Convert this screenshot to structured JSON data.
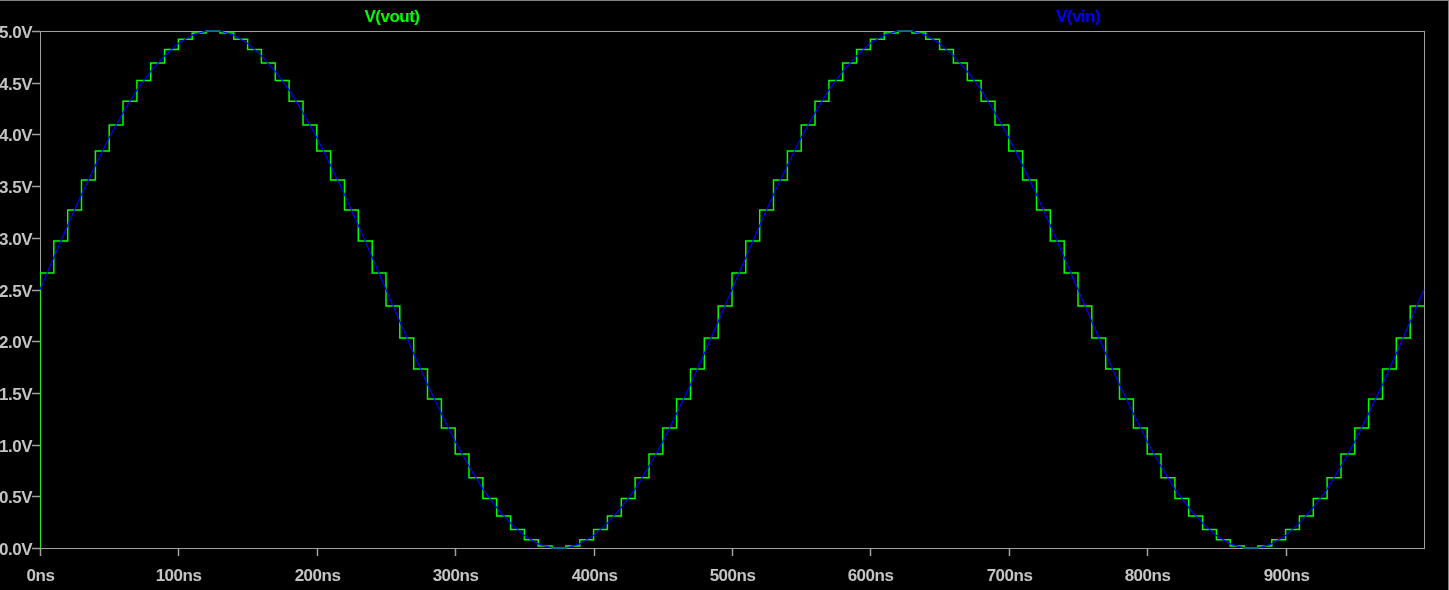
{
  "chart_data": {
    "type": "line",
    "xlim": [
      0,
      1000
    ],
    "ylim": [
      0,
      5
    ],
    "xticks": [
      {
        "value": 0,
        "label": "0ns"
      },
      {
        "value": 100,
        "label": "100ns"
      },
      {
        "value": 200,
        "label": "200ns"
      },
      {
        "value": 300,
        "label": "300ns"
      },
      {
        "value": 400,
        "label": "400ns"
      },
      {
        "value": 500,
        "label": "500ns"
      },
      {
        "value": 600,
        "label": "600ns"
      },
      {
        "value": 700,
        "label": "700ns"
      },
      {
        "value": 800,
        "label": "800ns"
      },
      {
        "value": 900,
        "label": "900ns"
      }
    ],
    "yticks": [
      {
        "value": 0,
        "label": "0.0V"
      },
      {
        "value": 0.5,
        "label": "0.5V"
      },
      {
        "value": 1,
        "label": "1.0V"
      },
      {
        "value": 1.5,
        "label": "1.5V"
      },
      {
        "value": 2,
        "label": "2.0V"
      },
      {
        "value": 2.5,
        "label": "2.5V"
      },
      {
        "value": 3,
        "label": "3.0V"
      },
      {
        "value": 3.5,
        "label": "3.5V"
      },
      {
        "value": 4,
        "label": "4.0V"
      },
      {
        "value": 4.5,
        "label": "4.5V"
      },
      {
        "value": 5,
        "label": "5.0V"
      }
    ],
    "x": [
      0,
      0,
      10,
      10,
      20,
      20,
      30,
      30,
      40,
      40,
      50,
      50,
      60,
      60,
      70,
      70,
      80,
      80,
      90,
      90,
      100,
      100,
      110,
      110,
      120,
      120,
      130,
      130,
      140,
      140,
      150,
      150,
      160,
      160,
      170,
      170,
      180,
      180,
      190,
      190,
      200,
      200,
      210,
      210,
      220,
      220,
      230,
      230,
      240,
      240,
      250,
      250,
      260,
      260,
      270,
      270,
      280,
      280,
      290,
      290,
      300,
      300,
      310,
      310,
      320,
      320,
      330,
      330,
      340,
      340,
      350,
      350,
      360,
      360,
      370,
      370,
      380,
      380,
      390,
      390,
      400,
      400,
      410,
      410,
      420,
      420,
      430,
      430,
      440,
      440,
      450,
      450,
      460,
      460,
      470,
      470,
      480,
      480,
      490,
      490,
      500,
      500,
      510,
      510,
      520,
      520,
      530,
      530,
      540,
      540,
      550,
      550,
      560,
      560,
      570,
      570,
      580,
      580,
      590,
      590,
      600,
      600,
      610,
      610,
      620,
      620,
      630,
      630,
      640,
      640,
      650,
      650,
      660,
      660,
      670,
      670,
      680,
      680,
      690,
      690,
      700,
      700,
      710,
      710,
      720,
      720,
      730,
      730,
      740,
      740,
      750,
      750,
      760,
      760,
      770,
      770,
      780,
      780,
      790,
      790,
      800,
      800,
      810,
      810,
      820,
      820,
      830,
      830,
      840,
      840,
      850,
      850,
      860,
      860,
      870,
      870,
      880,
      880,
      890,
      890,
      900,
      900,
      910,
      910,
      920,
      920,
      930,
      930,
      940,
      940,
      950,
      950,
      960,
      960,
      970,
      970,
      980,
      980,
      990,
      990,
      1000
    ],
    "series": [
      {
        "name": "V(vout)",
        "color": "#00ff00",
        "values": [
          0.0,
          2.66,
          2.66,
          2.97,
          2.97,
          3.27,
          3.27,
          3.56,
          3.56,
          3.84,
          3.84,
          4.09,
          4.09,
          4.32,
          4.32,
          4.52,
          4.52,
          4.69,
          4.69,
          4.82,
          4.82,
          4.92,
          4.92,
          4.98,
          4.98,
          5.0,
          5.0,
          4.98,
          4.98,
          4.92,
          4.92,
          4.82,
          4.82,
          4.69,
          4.69,
          4.52,
          4.52,
          4.32,
          4.32,
          4.09,
          4.09,
          3.84,
          3.84,
          3.56,
          3.56,
          3.27,
          3.27,
          2.97,
          2.97,
          2.66,
          2.66,
          2.34,
          2.34,
          2.03,
          2.03,
          1.73,
          1.73,
          1.44,
          1.44,
          1.16,
          1.16,
          0.91,
          0.91,
          0.68,
          0.68,
          0.48,
          0.48,
          0.31,
          0.31,
          0.18,
          0.18,
          0.08,
          0.08,
          0.02,
          0.02,
          0.0,
          0.0,
          0.02,
          0.02,
          0.08,
          0.08,
          0.18,
          0.18,
          0.31,
          0.31,
          0.48,
          0.48,
          0.68,
          0.68,
          0.91,
          0.91,
          1.16,
          1.16,
          1.44,
          1.44,
          1.73,
          1.73,
          2.03,
          2.03,
          2.34,
          2.34,
          2.66,
          2.66,
          2.97,
          2.97,
          3.27,
          3.27,
          3.56,
          3.56,
          3.84,
          3.84,
          4.09,
          4.09,
          4.32,
          4.32,
          4.52,
          4.52,
          4.69,
          4.69,
          4.82,
          4.82,
          4.92,
          4.92,
          4.98,
          4.98,
          5.0,
          5.0,
          4.98,
          4.98,
          4.92,
          4.92,
          4.82,
          4.82,
          4.69,
          4.69,
          4.52,
          4.52,
          4.32,
          4.32,
          4.09,
          4.09,
          3.84,
          3.84,
          3.56,
          3.56,
          3.27,
          3.27,
          2.97,
          2.97,
          2.66,
          2.66,
          2.34,
          2.34,
          2.03,
          2.03,
          1.73,
          1.73,
          1.44,
          1.44,
          1.16,
          1.16,
          0.91,
          0.91,
          0.68,
          0.68,
          0.48,
          0.48,
          0.31,
          0.31,
          0.18,
          0.18,
          0.08,
          0.08,
          0.02,
          0.02,
          0.0,
          0.0,
          0.02,
          0.02,
          0.08,
          0.08,
          0.18,
          0.18,
          0.31,
          0.31,
          0.48,
          0.48,
          0.68,
          0.68,
          0.91,
          0.91,
          1.16,
          1.16,
          1.44,
          1.44,
          1.73,
          1.73,
          2.03,
          2.03,
          2.34,
          2.34
        ]
      },
      {
        "name": "V(vin)",
        "color": "#0000ff",
        "values": [
          2.5,
          2.5,
          2.81,
          2.81,
          3.12,
          3.12,
          3.42,
          3.42,
          3.7,
          3.7,
          3.97,
          3.97,
          4.21,
          4.21,
          4.43,
          4.43,
          4.61,
          4.61,
          4.76,
          4.76,
          4.88,
          4.88,
          4.96,
          4.96,
          5.0,
          5.0,
          5.0,
          5.0,
          4.96,
          4.96,
          4.88,
          4.88,
          4.76,
          4.76,
          4.61,
          4.61,
          4.43,
          4.43,
          4.21,
          4.21,
          3.97,
          3.97,
          3.7,
          3.7,
          3.42,
          3.42,
          3.12,
          3.12,
          2.81,
          2.81,
          2.5,
          2.5,
          2.19,
          2.19,
          1.88,
          1.88,
          1.58,
          1.58,
          1.3,
          1.3,
          1.03,
          1.03,
          0.79,
          0.79,
          0.57,
          0.57,
          0.39,
          0.39,
          0.24,
          0.24,
          0.12,
          0.12,
          0.04,
          0.04,
          0.0,
          0.0,
          0.0,
          0.0,
          0.04,
          0.04,
          0.12,
          0.12,
          0.24,
          0.24,
          0.39,
          0.39,
          0.57,
          0.57,
          0.79,
          0.79,
          1.03,
          1.03,
          1.3,
          1.3,
          1.58,
          1.58,
          1.88,
          1.88,
          2.19,
          2.19,
          2.5,
          2.5,
          2.81,
          2.81,
          3.12,
          3.12,
          3.42,
          3.42,
          3.7,
          3.7,
          3.97,
          3.97,
          4.21,
          4.21,
          4.43,
          4.43,
          4.61,
          4.61,
          4.76,
          4.76,
          4.88,
          4.88,
          4.96,
          4.96,
          5.0,
          5.0,
          5.0,
          5.0,
          4.96,
          4.96,
          4.88,
          4.88,
          4.76,
          4.76,
          4.61,
          4.61,
          4.43,
          4.43,
          4.21,
          4.21,
          3.97,
          3.97,
          3.7,
          3.7,
          3.42,
          3.42,
          3.12,
          3.12,
          2.81,
          2.81,
          2.5,
          2.5,
          2.19,
          2.19,
          1.88,
          1.88,
          1.58,
          1.58,
          1.3,
          1.3,
          1.03,
          1.03,
          0.79,
          0.79,
          0.57,
          0.57,
          0.39,
          0.39,
          0.24,
          0.24,
          0.12,
          0.12,
          0.04,
          0.04,
          0.0,
          0.0,
          0.0,
          0.0,
          0.04,
          0.04,
          0.12,
          0.12,
          0.24,
          0.24,
          0.39,
          0.39,
          0.57,
          0.57,
          0.79,
          0.79,
          1.03,
          1.03,
          1.3,
          1.3,
          1.58,
          1.58,
          1.88,
          1.88,
          2.19,
          2.19,
          2.5
        ]
      }
    ]
  }
}
